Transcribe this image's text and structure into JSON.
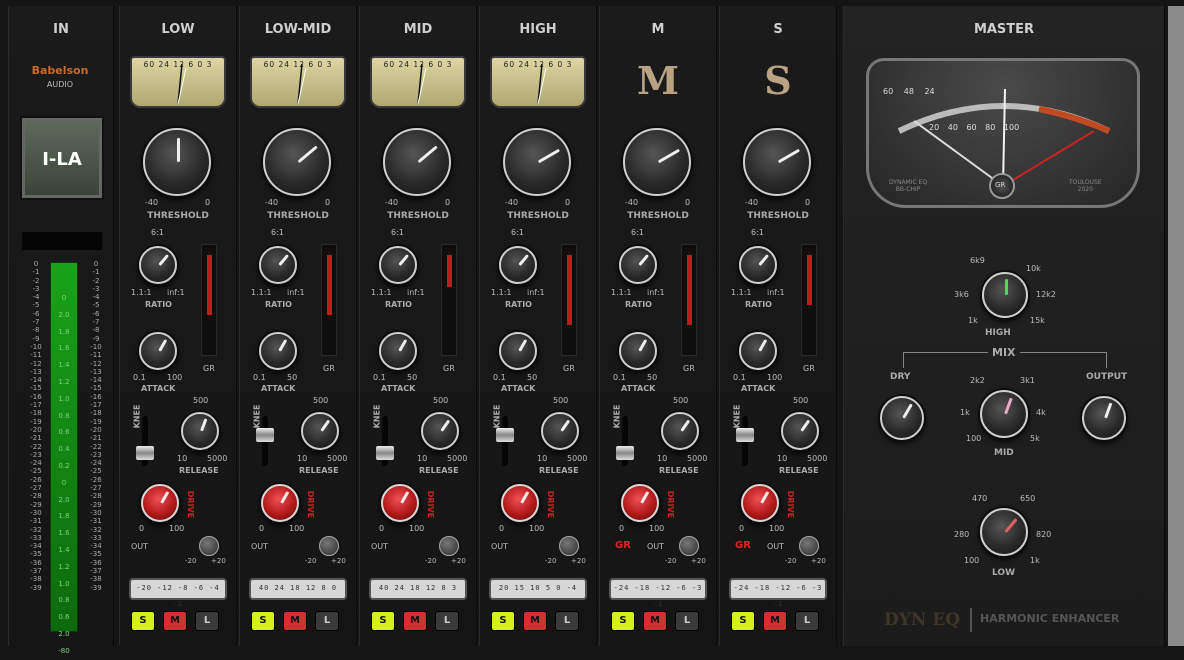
{
  "in_section": {
    "title": "IN",
    "brand": "Babelson",
    "brand_sub": "AUDIO",
    "model": "I-LA",
    "scale": [
      "0",
      "-1",
      "-2",
      "-3",
      "-4",
      "-5",
      "-6",
      "-7",
      "-8",
      "-9",
      "-10",
      "-11",
      "-12",
      "-13",
      "-14",
      "-15",
      "-16",
      "-17",
      "-18",
      "-19",
      "-20",
      "-21",
      "-22",
      "-23",
      "-24",
      "-25",
      "-26",
      "-27",
      "-28",
      "-29",
      "-30",
      "-31",
      "-32",
      "-33",
      "-34",
      "-35",
      "-36",
      "-37",
      "-38",
      "-39"
    ],
    "meter_labels": [
      "0",
      "2.0",
      "1.8",
      "1.6",
      "1.4",
      "1.2",
      "1.0",
      "0.8",
      "0.6",
      "0.4",
      "0.2",
      "0",
      "2.0",
      "1.8",
      "1.6",
      "1.4",
      "1.2",
      "1.0",
      "0.8",
      "0.6",
      "2.0",
      "-80"
    ]
  },
  "bands": [
    {
      "title": "LOW",
      "vu": "60 24 12 6 0 3",
      "ratio_min": "1.1:1",
      "ratio_max": "inf:1",
      "ratio_top": "6:1",
      "attack_min": "0.1",
      "attack_max": "100",
      "rel_top": "500",
      "rel_min": "10",
      "rel_max": "5000",
      "drive_min": "0",
      "drive_max": "100",
      "leds": "-20 -12 -8 -6 -4 -2"
    },
    {
      "title": "LOW-MID",
      "vu": "60 24 12 6 0 3",
      "ratio_min": "1.1:1",
      "ratio_max": "inf:1",
      "ratio_top": "6:1",
      "attack_min": "0.1",
      "attack_max": "50",
      "rel_top": "500",
      "rel_min": "10",
      "rel_max": "5000",
      "drive_min": "0",
      "drive_max": "100",
      "leds": "40 24 18 12 8 0"
    },
    {
      "title": "MID",
      "vu": "60 24 12 6 0 3",
      "ratio_min": "1.1:1",
      "ratio_max": "inf:1",
      "ratio_top": "6:1",
      "attack_min": "0.1",
      "attack_max": "50",
      "rel_top": "500",
      "rel_min": "10",
      "rel_max": "5000",
      "drive_min": "0",
      "drive_max": "100",
      "leds": "40 24 18 12 8 3"
    },
    {
      "title": "HIGH",
      "vu": "60 24 12 6 0 3",
      "ratio_min": "1.1:1",
      "ratio_max": "inf:1",
      "ratio_top": "6:1",
      "attack_min": "0.1",
      "attack_max": "50",
      "rel_top": "500",
      "rel_min": "10",
      "rel_max": "5000",
      "drive_min": "0",
      "drive_max": "100",
      "leds": "20 15 10 5 0 -4"
    },
    {
      "title": "M",
      "vu": "",
      "ratio_min": "1.1:1",
      "ratio_max": "inf:1",
      "ratio_top": "6:1",
      "attack_min": "0.1",
      "attack_max": "50",
      "rel_top": "500",
      "rel_min": "10",
      "rel_max": "5000",
      "drive_min": "0",
      "drive_max": "100",
      "leds": "-24 -18 -12 -6 -3 -1"
    },
    {
      "title": "S",
      "vu": "",
      "ratio_min": "1.1:1",
      "ratio_max": "inf:1",
      "ratio_top": "6:1",
      "attack_min": "0.1",
      "attack_max": "100",
      "rel_top": "500",
      "rel_min": "10",
      "rel_max": "5000",
      "drive_min": "0",
      "drive_max": "100",
      "leds": "-24 -18 -12 -6 -3 -1"
    }
  ],
  "strip_labels": {
    "threshold": "THRESHOLD",
    "thr_min": "-40",
    "thr_max": "0",
    "ratio": "RATIO",
    "attack": "ATTACK",
    "gr": "GR",
    "knee": "KNEE",
    "release": "RELEASE",
    "drive": "DRIVE",
    "out": "OUT",
    "out_min": "-20",
    "out_max": "+20",
    "gr_arrow": "GR",
    "solo": "S",
    "mute": "M",
    "listen": "L"
  },
  "master": {
    "title": "MASTER",
    "meter_scale": "60 48 24",
    "meter_scale2": "20 40 60 80 100",
    "meter_left": "DYNAMIC EQ",
    "meter_left2": "BB-CHIP",
    "meter_right": "TOULOUSE",
    "meter_right2": "2020",
    "meter_btn": "GR",
    "high": {
      "label": "HIGH",
      "t": "6k9",
      "tr": "10k",
      "l": "3k6",
      "r": "12k2",
      "bl": "1k",
      "br": "15k"
    },
    "mix": "MIX",
    "dry": "DRY",
    "output": "OUTPUT",
    "mid": {
      "label": "MID",
      "tl": "2k2",
      "tr": "3k1",
      "l": "1k",
      "r": "4k",
      "bl": "100",
      "br": "5k"
    },
    "low": {
      "label": "LOW",
      "tl": "470",
      "tr": "650",
      "l": "280",
      "r": "820",
      "bl": "100",
      "br": "1k"
    },
    "footer1": "DYN EQ",
    "footer2": "HARMONIC ENHANCER"
  }
}
